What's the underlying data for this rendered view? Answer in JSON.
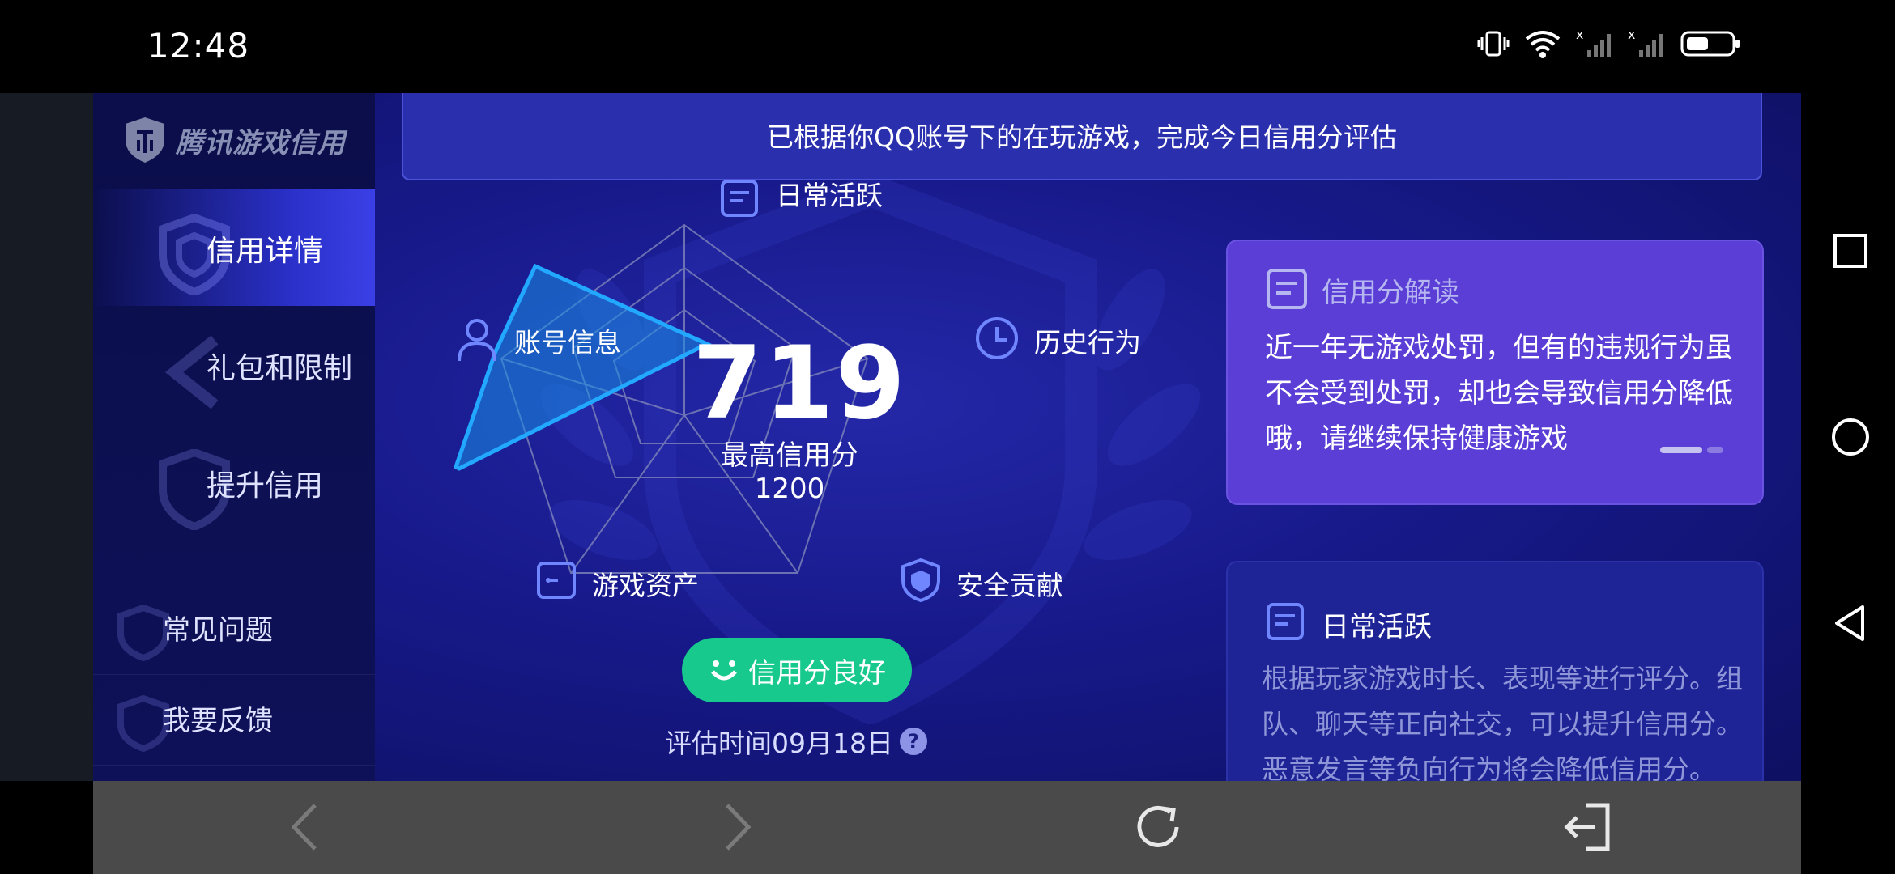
{
  "status_bar": {
    "time": "12:48"
  },
  "sidebar": {
    "logo_text": "腾讯游戏信用",
    "items": [
      {
        "label": "信用详情",
        "active": true
      },
      {
        "label": "礼包和限制",
        "active": false
      },
      {
        "label": "提升信用",
        "active": false
      }
    ],
    "sub_items": [
      {
        "label": "常见问题"
      },
      {
        "label": "我要反馈"
      }
    ]
  },
  "banner": {
    "text": "已根据你QQ账号下的在玩游戏，完成今日信用分评估"
  },
  "radar": {
    "score": "719",
    "max_label": "最高信用分1200",
    "axes": [
      {
        "label": "日常活跃",
        "icon": "document-icon"
      },
      {
        "label": "历史行为",
        "icon": "clock-icon"
      },
      {
        "label": "安全贡献",
        "icon": "shield-icon"
      },
      {
        "label": "游戏资产",
        "icon": "wallet-icon"
      },
      {
        "label": "账号信息",
        "icon": "user-icon"
      }
    ]
  },
  "status_button": {
    "label": "信用分良好",
    "icon": "smile-icon"
  },
  "eval_time": {
    "label": "评估时间09月18日",
    "help": "?"
  },
  "card_interpret": {
    "title": "信用分解读",
    "text": "近一年无游戏处罚，但有的违规行为虽不会受到处罚，却也会导致信用分降低哦，请继续保持健康游戏"
  },
  "card_daily": {
    "title": "日常活跃",
    "text": "根据玩家游戏时长、表现等进行评分。组队、聊天等正向社交，可以提升信用分。恶意发言等负向行为将会降低信用分。"
  },
  "colors": {
    "accent_green": "#17c98d",
    "card_purple": "#5a3ed6",
    "radar_fill": "#1a8ee6"
  }
}
